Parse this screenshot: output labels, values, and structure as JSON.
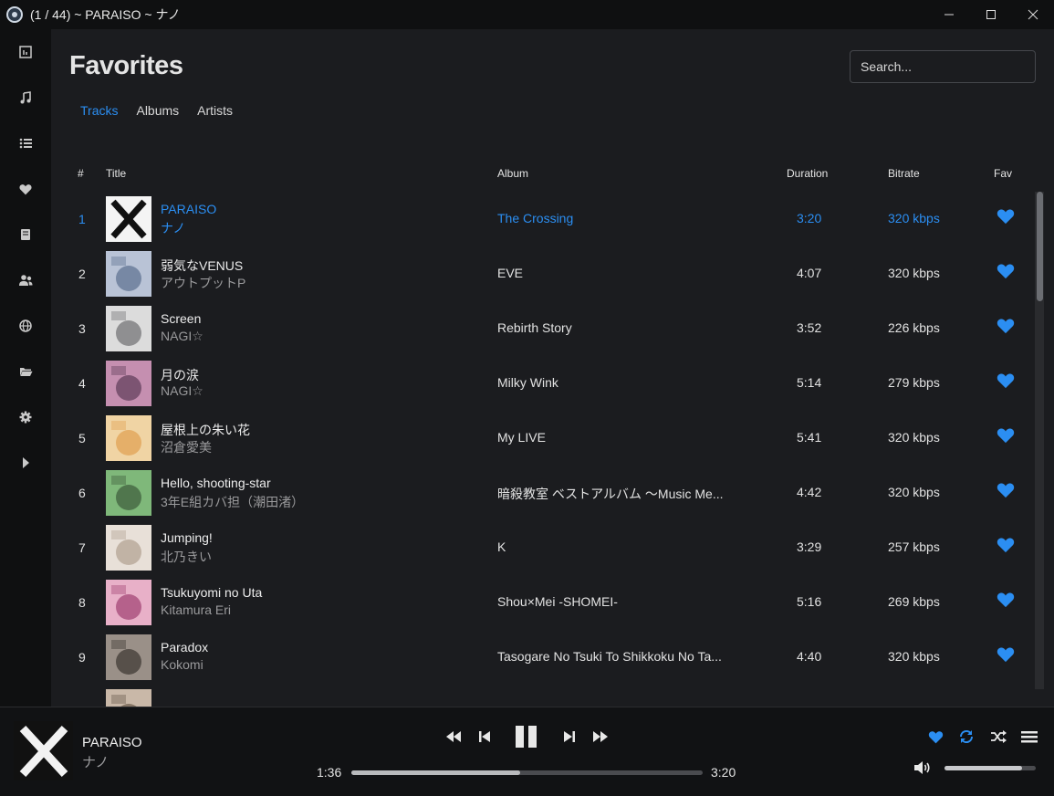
{
  "window": {
    "title": "(1 / 44) ~ PARAISO ~ ナノ",
    "minimize": "—",
    "maximize": "☐",
    "close": "✕"
  },
  "sidebar": {
    "items": [
      {
        "name": "dashboard-icon",
        "glyph": "▤"
      },
      {
        "name": "music-note-icon",
        "glyph": "♫"
      },
      {
        "name": "list-icon",
        "glyph": "☰"
      },
      {
        "name": "heart-icon",
        "glyph": "♥"
      },
      {
        "name": "book-icon",
        "glyph": "▮"
      },
      {
        "name": "users-icon",
        "glyph": "⚇"
      },
      {
        "name": "globe-icon",
        "glyph": "◎"
      },
      {
        "name": "folder-icon",
        "glyph": "▰"
      },
      {
        "name": "gear-icon",
        "glyph": "⚙"
      },
      {
        "name": "play-icon",
        "glyph": "▶"
      }
    ]
  },
  "page": {
    "title": "Favorites",
    "search_placeholder": "Search..."
  },
  "tabs": [
    {
      "label": "Tracks",
      "active": true
    },
    {
      "label": "Albums",
      "active": false
    },
    {
      "label": "Artists",
      "active": false
    }
  ],
  "table": {
    "headers": {
      "num": "#",
      "title": "Title",
      "album": "Album",
      "duration": "Duration",
      "bitrate": "Bitrate",
      "fav": "Fav"
    },
    "rows": [
      {
        "num": "1",
        "title": "PARAISO",
        "artist": "ナノ",
        "album": "The Crossing",
        "duration": "3:20",
        "bitrate": "320 kbps",
        "active": true,
        "art": [
          "#f4f4f4",
          "#111111"
        ]
      },
      {
        "num": "2",
        "title": "弱気なVENUS",
        "artist": "アウトプットP",
        "album": "EVE",
        "duration": "4:07",
        "bitrate": "320 kbps",
        "art": [
          "#b9c3d6",
          "#5b6f8f"
        ]
      },
      {
        "num": "3",
        "title": "Screen",
        "artist": "NAGI☆",
        "album": "Rebirth Story",
        "duration": "3:52",
        "bitrate": "226 kbps",
        "art": [
          "#dcdcdc",
          "#6d6d70"
        ]
      },
      {
        "num": "4",
        "title": "月の涙",
        "artist": "NAGI☆",
        "album": "Milky Wink",
        "duration": "5:14",
        "bitrate": "279 kbps",
        "art": [
          "#c58fb0",
          "#5c3a58"
        ]
      },
      {
        "num": "5",
        "title": "屋根上の朱い花",
        "artist": "沼倉愛美",
        "album": "My LIVE",
        "duration": "5:41",
        "bitrate": "320 kbps",
        "art": [
          "#f0d4a4",
          "#e0a050"
        ]
      },
      {
        "num": "6",
        "title": "Hello, shooting-star",
        "artist": "3年E組カバ担（潮田渚）",
        "album": "暗殺教室 ベストアルバム ～Music Me...",
        "duration": "4:42",
        "bitrate": "320 kbps",
        "art": [
          "#7fb87a",
          "#3c5a3a"
        ]
      },
      {
        "num": "7",
        "title": "Jumping!",
        "artist": "北乃きい",
        "album": "K",
        "duration": "3:29",
        "bitrate": "257 kbps",
        "art": [
          "#e8e0d8",
          "#b0a090"
        ]
      },
      {
        "num": "8",
        "title": "Tsukuyomi no Uta",
        "artist": "Kitamura Eri",
        "album": "Shou×Mei -SHOMEI-",
        "duration": "5:16",
        "bitrate": "269 kbps",
        "art": [
          "#e8b0c8",
          "#a04070"
        ]
      },
      {
        "num": "9",
        "title": "Paradox",
        "artist": "Kokomi",
        "album": "Tasogare No Tsuki To Shikkoku No Ta...",
        "duration": "4:40",
        "bitrate": "320 kbps",
        "art": [
          "#9a9088",
          "#3a3430"
        ]
      },
      {
        "num": "",
        "title": "",
        "artist": "",
        "album": "",
        "duration": "",
        "bitrate": "",
        "partial": true,
        "art": [
          "#c9b8a8",
          "#6a5a4a"
        ]
      }
    ]
  },
  "player": {
    "title": "PARAISO",
    "artist": "ナノ",
    "elapsed": "1:36",
    "total": "3:20",
    "progress": 0.48,
    "volume": 0.85
  },
  "colors": {
    "accent": "#2b8ef2",
    "background": "#1b1c1f",
    "sidebar": "#0f1011"
  }
}
